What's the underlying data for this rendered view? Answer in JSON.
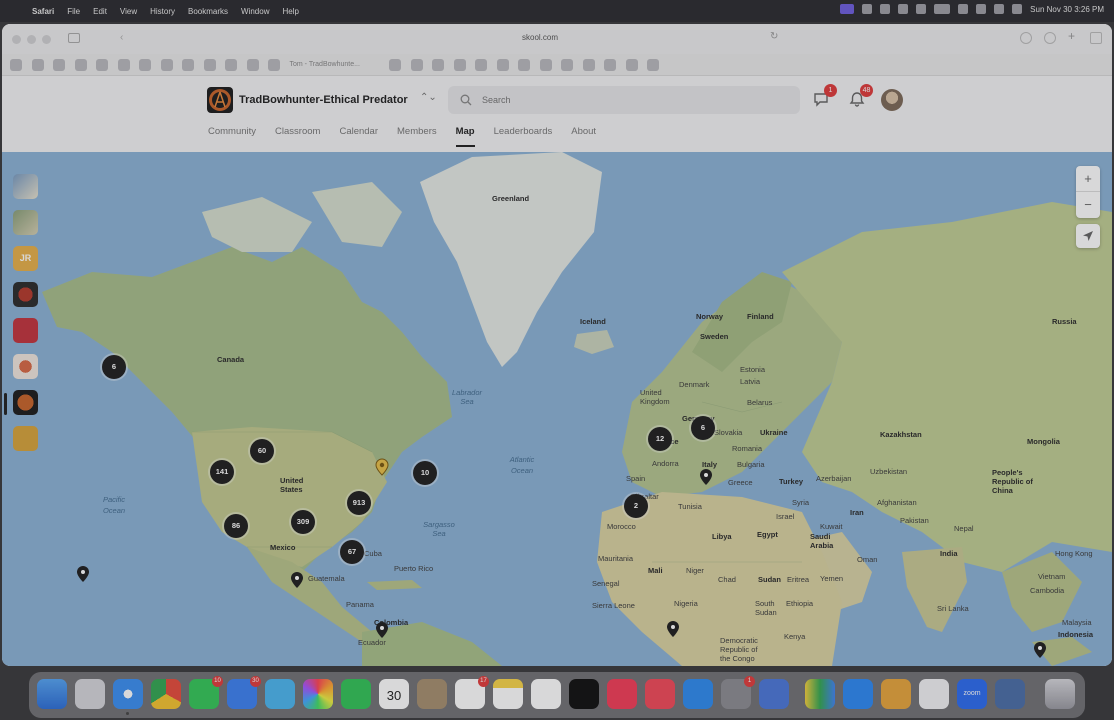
{
  "menubar": {
    "app": "Safari",
    "menus": [
      "File",
      "Edit",
      "View",
      "History",
      "Bookmarks",
      "Window",
      "Help"
    ],
    "datetime": "Sun Nov 30  3:26 PM"
  },
  "browser": {
    "url": "skool.com",
    "favorite_text": "Tom - TradBowhunte..."
  },
  "header": {
    "group_name": "TradBowhunter-Ethical Predator",
    "search_placeholder": "Search",
    "chat_badge": "1",
    "notif_badge": "48"
  },
  "nav": {
    "tabs": [
      {
        "label": "Community",
        "active": false
      },
      {
        "label": "Classroom",
        "active": false
      },
      {
        "label": "Calendar",
        "active": false
      },
      {
        "label": "Members",
        "active": false
      },
      {
        "label": "Map",
        "active": true
      },
      {
        "label": "Leaderboards",
        "active": false
      },
      {
        "label": "About",
        "active": false
      }
    ]
  },
  "left_groups": {
    "jr_label": "JR"
  },
  "map": {
    "zoom_in": "+",
    "zoom_out": "−",
    "labels": {
      "greenland": "Greenland",
      "canada": "Canada",
      "iceland": "Iceland",
      "norway": "Norway",
      "finland": "Finland",
      "sweden": "Sweden",
      "estonia": "Estonia",
      "latvia": "Latvia",
      "denmark": "Denmark",
      "belarus": "Belarus",
      "united_kingdom": "United Kingdom",
      "germany": "Germany",
      "ukraine": "Ukraine",
      "france": "France",
      "slovakia": "Slovakia",
      "romania": "Romania",
      "andorra": "Andorra",
      "italy": "Italy",
      "bulgaria": "Bulgaria",
      "spain": "Spain",
      "greece": "Greece",
      "turkey": "Turkey",
      "gibraltar": "Gibraltar",
      "tunisia": "Tunisia",
      "syria": "Syria",
      "azerbaijan": "Azerbaijan",
      "russia": "Russia",
      "kazakhstan": "Kazakhstan",
      "mongolia": "Mongolia",
      "uzbekistan": "Uzbekistan",
      "china": "People's Republic of China",
      "afghanistan": "Afghanistan",
      "iran": "Iran",
      "pakistan": "Pakistan",
      "kuwait": "Kuwait",
      "israel": "Israel",
      "nepal": "Nepal",
      "india": "India",
      "hong_kong": "Hong Kong",
      "saudi_arabia": "Saudi Arabia",
      "oman": "Oman",
      "yemen": "Yemen",
      "morocco": "Morocco",
      "libya": "Libya",
      "egypt": "Egypt",
      "mauritania": "Mauritania",
      "mali": "Mali",
      "niger": "Niger",
      "chad": "Chad",
      "sudan": "Sudan",
      "eritrea": "Eritrea",
      "senegal": "Senegal",
      "sierra_leone": "Sierra Leone",
      "nigeria": "Nigeria",
      "south_sudan": "South Sudan",
      "ethiopia": "Ethiopia",
      "kenya": "Kenya",
      "drc": "Democratic Republic of the Congo",
      "sri_lanka": "Sri Lanka",
      "vietnam": "Vietnam",
      "cambodia": "Cambodia",
      "malaysia": "Malaysia",
      "indonesia": "Indonesia",
      "united_states": "United States",
      "mexico": "Mexico",
      "guatemala": "Guatemala",
      "cuba": "Cuba",
      "puerto_rico": "Puerto Rico",
      "panama": "Panama",
      "colombia": "Colombia",
      "ecuador": "Ecuador",
      "atlantic_ocean": "Atlantic Ocean",
      "pacific_ocean": "Pacific Ocean",
      "labrador_sea": "Labrador Sea",
      "sargasso_sea": "Sargasso Sea"
    },
    "clusters": {
      "alaska": "6",
      "canada_west": "60",
      "us_northwest": "141",
      "us_east": "913",
      "us_northeast": "10",
      "us_central": "309",
      "us_southwest": "86",
      "us_southeast": "67",
      "uk": "12",
      "germany": "6",
      "spain": "2"
    }
  },
  "dock": {
    "calendar_day": "30",
    "calendar_month": "NOV",
    "badges": {
      "messages": "10",
      "mail": "30",
      "reminders": "17",
      "facetime": "1"
    }
  }
}
